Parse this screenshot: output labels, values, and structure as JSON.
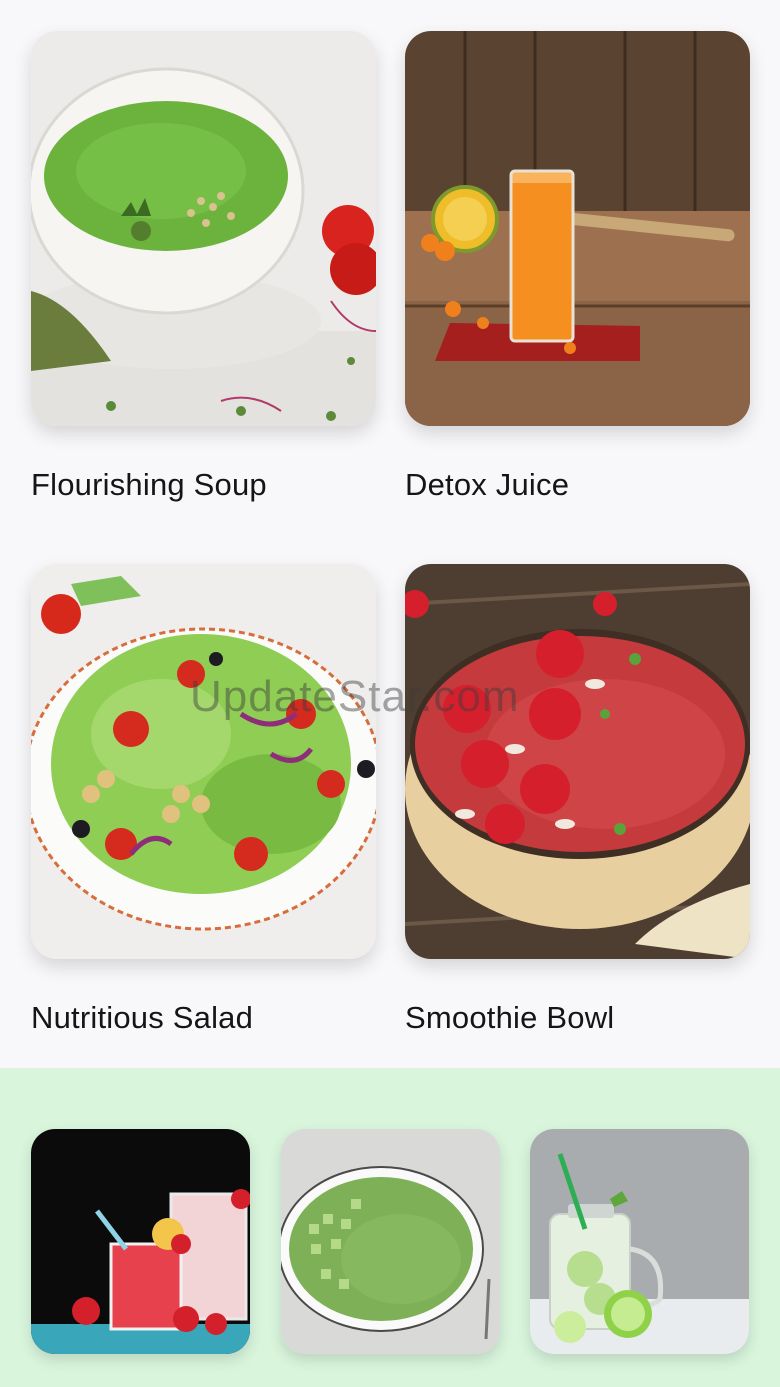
{
  "cards": [
    {
      "label": "Flourishing Soup",
      "image": "green-soup-bowl-photo"
    },
    {
      "label": "Detox Juice",
      "image": "orange-juice-glass-photo"
    },
    {
      "label": "Nutritious Salad",
      "image": "vegetable-salad-plate-photo"
    },
    {
      "label": "Smoothie Bowl",
      "image": "strawberry-smoothie-bowl-photo"
    }
  ],
  "watermark": "UpdateStar.com",
  "strip": {
    "background": "#d9f6dd",
    "thumbnails": [
      {
        "image": "strawberry-smoothie-drinks-photo"
      },
      {
        "image": "cucumber-soup-photo"
      },
      {
        "image": "lime-water-jar-photo"
      }
    ]
  }
}
